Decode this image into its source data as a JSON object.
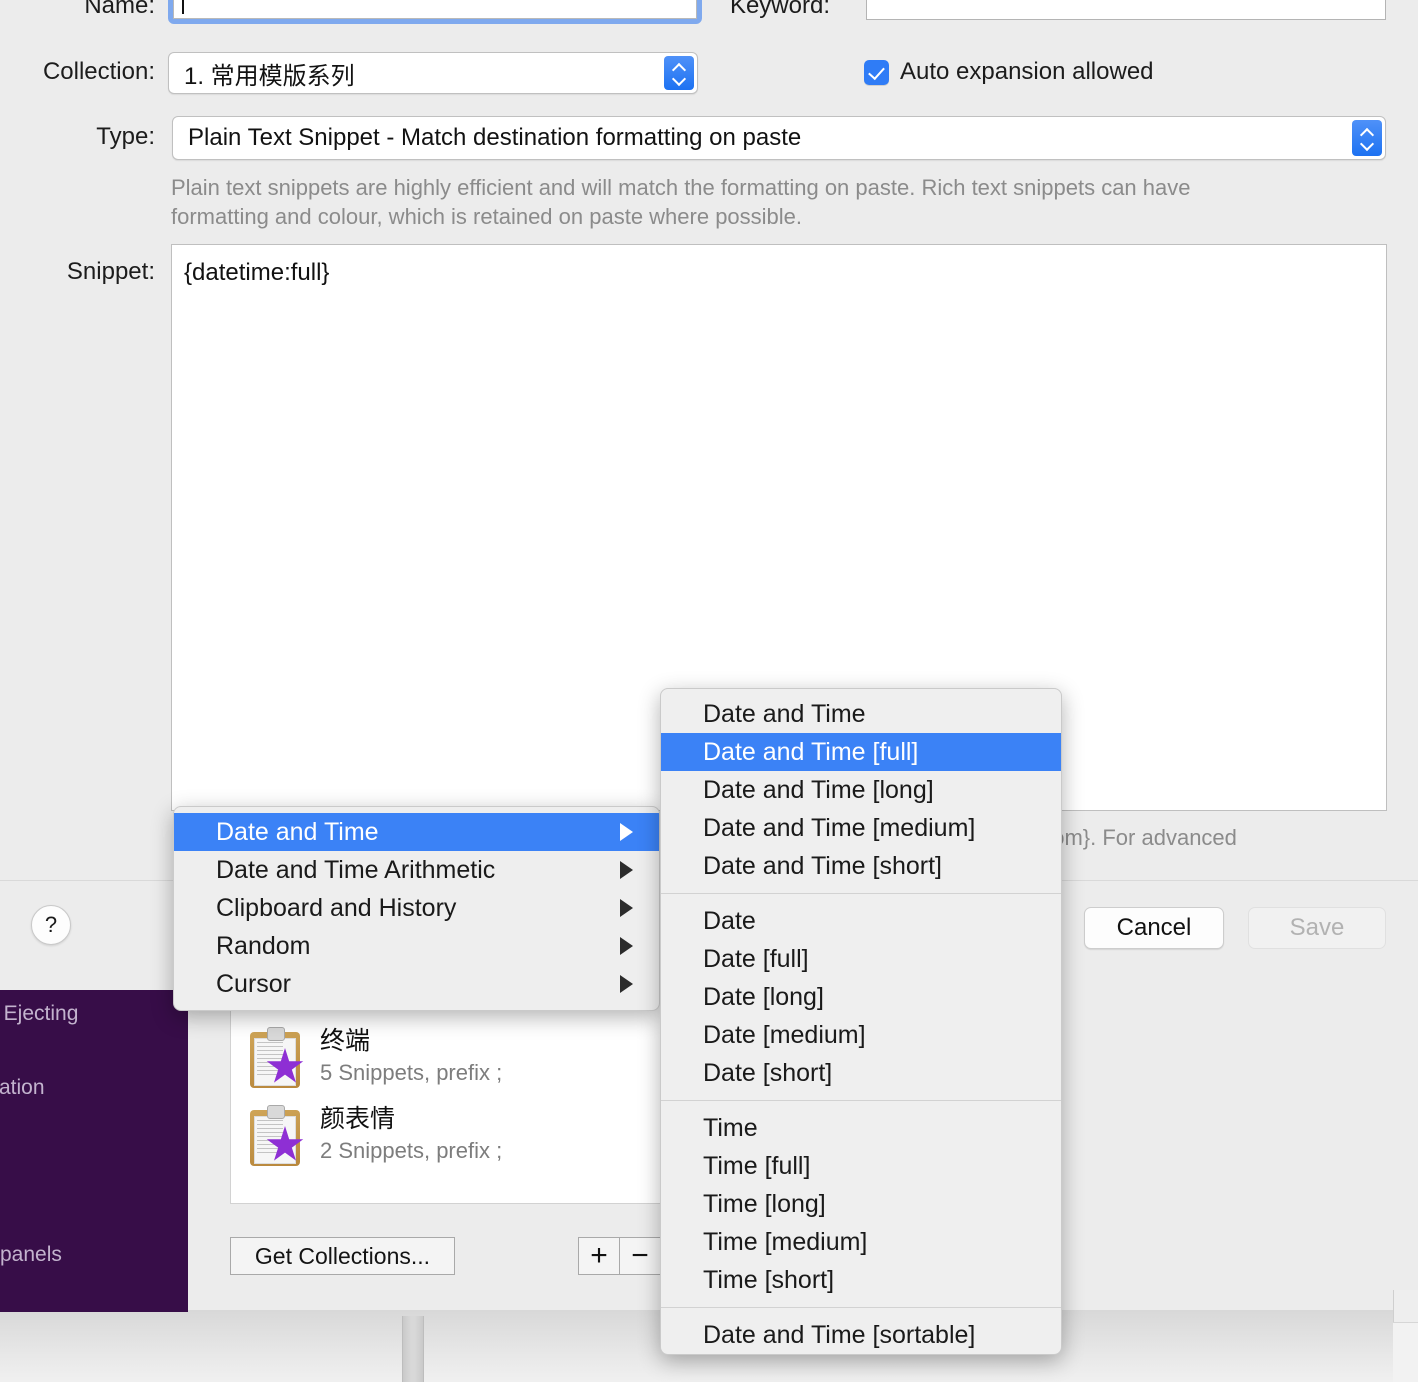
{
  "form": {
    "name_label": "Name:",
    "name_value": "",
    "keyword_label": "Keyword:",
    "keyword_value": "",
    "collection_label": "Collection:",
    "collection_value": "1. 常用模版系列",
    "auto_expansion_label": "Auto expansion allowed",
    "auto_expansion_checked": true,
    "type_label": "Type:",
    "type_value": "Plain Text Snippet - Match destination formatting on paste",
    "helper_text": "Plain text snippets are highly efficient and will match the formatting on paste. Rich text snippets can have formatting and colour, which is retained on paste where possible.",
    "snippet_label": "Snippet:",
    "snippet_value": "{datetime:full}",
    "helper_text_truncated": "dom}. For advanced",
    "help_button": "?",
    "cancel_label": "Cancel",
    "save_label": "Save"
  },
  "collections": {
    "items": [
      {
        "title": "终端",
        "subtitle": "5 Snippets, prefix ;"
      },
      {
        "title": "颜表情",
        "subtitle": "2 Snippets, prefix ;"
      }
    ],
    "get_collections_label": "Get Collections...",
    "add_label": "+",
    "remove_label": "−"
  },
  "background_app": {
    "lines": [
      ", Ejecting",
      "ration",
      "panels"
    ],
    "sidebar_color": "#370d48"
  },
  "context_menu": {
    "items": [
      {
        "label": "Date and Time",
        "selected": true,
        "has_submenu": true
      },
      {
        "label": "Date and Time Arithmetic",
        "selected": false,
        "has_submenu": true
      },
      {
        "label": "Clipboard and History",
        "selected": false,
        "has_submenu": true
      },
      {
        "label": "Random",
        "selected": false,
        "has_submenu": true
      },
      {
        "label": "Cursor",
        "selected": false,
        "has_submenu": true
      }
    ]
  },
  "submenu": {
    "groups": [
      {
        "items": [
          {
            "label": "Date and Time",
            "selected": false
          },
          {
            "label": "Date and Time [full]",
            "selected": true
          },
          {
            "label": "Date and Time [long]",
            "selected": false
          },
          {
            "label": "Date and Time [medium]",
            "selected": false
          },
          {
            "label": "Date and Time [short]",
            "selected": false
          }
        ]
      },
      {
        "items": [
          {
            "label": "Date",
            "selected": false
          },
          {
            "label": "Date [full]",
            "selected": false
          },
          {
            "label": "Date [long]",
            "selected": false
          },
          {
            "label": "Date [medium]",
            "selected": false
          },
          {
            "label": "Date [short]",
            "selected": false
          }
        ]
      },
      {
        "items": [
          {
            "label": "Time",
            "selected": false
          },
          {
            "label": "Time [full]",
            "selected": false
          },
          {
            "label": "Time [long]",
            "selected": false
          },
          {
            "label": "Time [medium]",
            "selected": false
          },
          {
            "label": "Time [short]",
            "selected": false
          }
        ]
      },
      {
        "items": [
          {
            "label": "Date and Time [sortable]",
            "selected": false
          }
        ]
      }
    ]
  },
  "colors": {
    "accent_blue": "#3b82f6",
    "selection_blue": "#2f7cf6",
    "sidebar_purple": "#370d48",
    "star_purple": "#8e2fd4",
    "window_bg": "#ececec"
  }
}
